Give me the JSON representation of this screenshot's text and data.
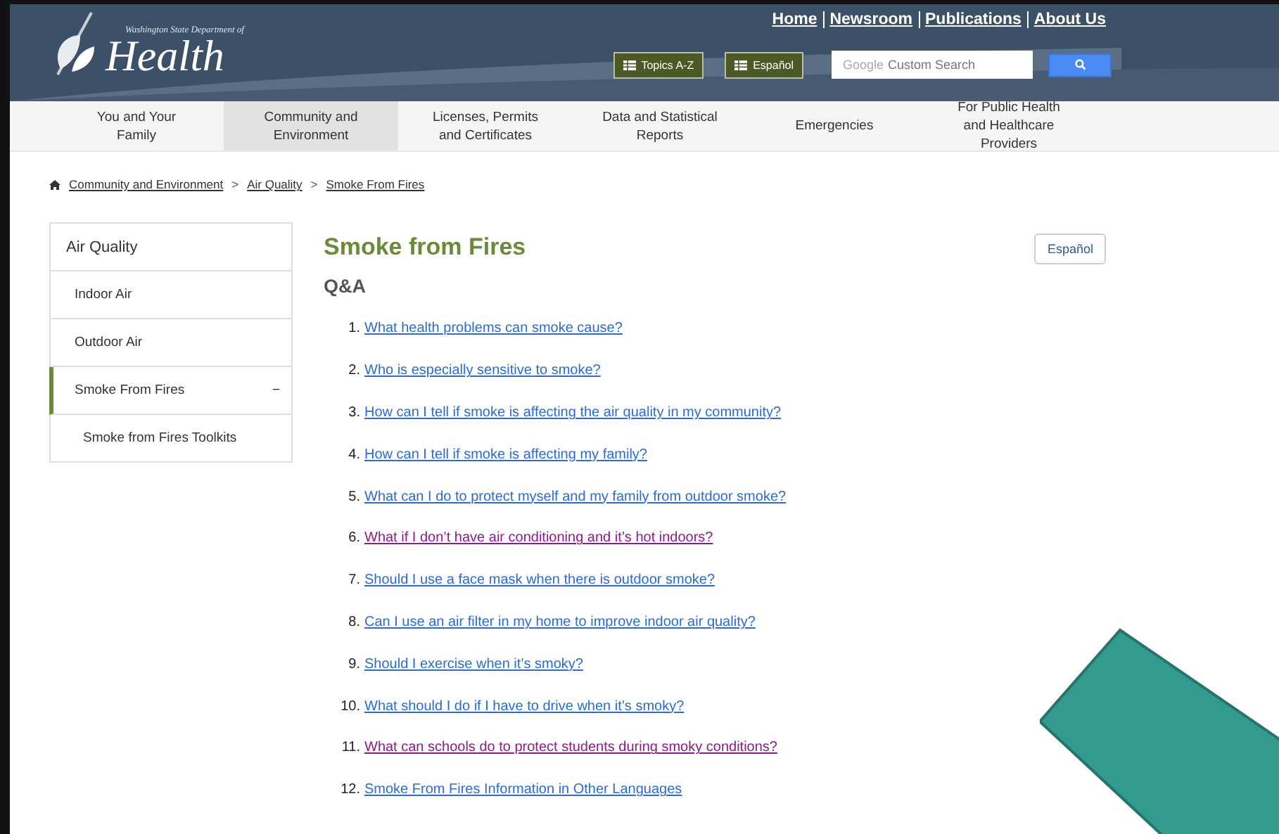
{
  "logo": {
    "subtitle": "Washington State Department of",
    "title": "Health"
  },
  "top_links": [
    "Home",
    "Newsroom",
    "Publications",
    "About Us"
  ],
  "header_buttons": [
    "Topics A-Z",
    "Español"
  ],
  "search": {
    "placeholder_brand": "Google",
    "placeholder": "Custom Search"
  },
  "nav": [
    {
      "label": "You and Your Family",
      "selected": false
    },
    {
      "label": "Community and Environment",
      "selected": true
    },
    {
      "label": "Licenses, Permits and Certificates",
      "selected": false
    },
    {
      "label": "Data and Statistical Reports",
      "selected": false
    },
    {
      "label": "Emergencies",
      "selected": false
    },
    {
      "label": "For Public Health and Healthcare Providers",
      "selected": false
    }
  ],
  "breadcrumb": [
    "Community and Environment",
    "Air Quality",
    "Smoke From Fires"
  ],
  "breadcrumb_separator": ">",
  "sidebar": {
    "title": "Air Quality",
    "items": [
      {
        "label": "Indoor Air",
        "selected": false
      },
      {
        "label": "Outdoor Air",
        "selected": false
      },
      {
        "label": "Smoke From Fires",
        "selected": true,
        "expanded": true,
        "toggle": "−",
        "children": [
          {
            "label": "Smoke from Fires Toolkits"
          }
        ]
      }
    ]
  },
  "page_title": "Smoke from Fires",
  "language_button": "Español",
  "section_heading": "Q&A",
  "questions": [
    {
      "number": "1.",
      "text": "What health problems can smoke cause?",
      "visited": false
    },
    {
      "number": "2.",
      "text": "Who is especially sensitive to smoke?",
      "visited": false
    },
    {
      "number": "3.",
      "text": "How can I tell if smoke is affecting the air quality in my community?",
      "visited": false
    },
    {
      "number": "4.",
      "text": "How can I tell if smoke is affecting my family?",
      "visited": false
    },
    {
      "number": "5.",
      "text": "What can I do to protect myself and my family from outdoor smoke?",
      "visited": false
    },
    {
      "number": "6.",
      "text": "What if I don’t have air conditioning and it’s hot indoors?",
      "visited": true
    },
    {
      "number": "7.",
      "text": "Should I use a face mask when there is outdoor smoke?",
      "visited": false
    },
    {
      "number": "8.",
      "text": "Can I use an air filter in my home to improve indoor air quality?",
      "visited": false
    },
    {
      "number": "9.",
      "text": "Should I exercise when it’s smoky?",
      "visited": false
    },
    {
      "number": "10.",
      "text": "What should I do if I have to drive when it’s smoky?",
      "visited": false
    },
    {
      "number": "11.",
      "text": "What can schools do to protect students during smoky conditions?",
      "visited": true
    },
    {
      "number": "12.",
      "text": "Smoke From Fires Information in Other Languages",
      "visited": false
    }
  ]
}
